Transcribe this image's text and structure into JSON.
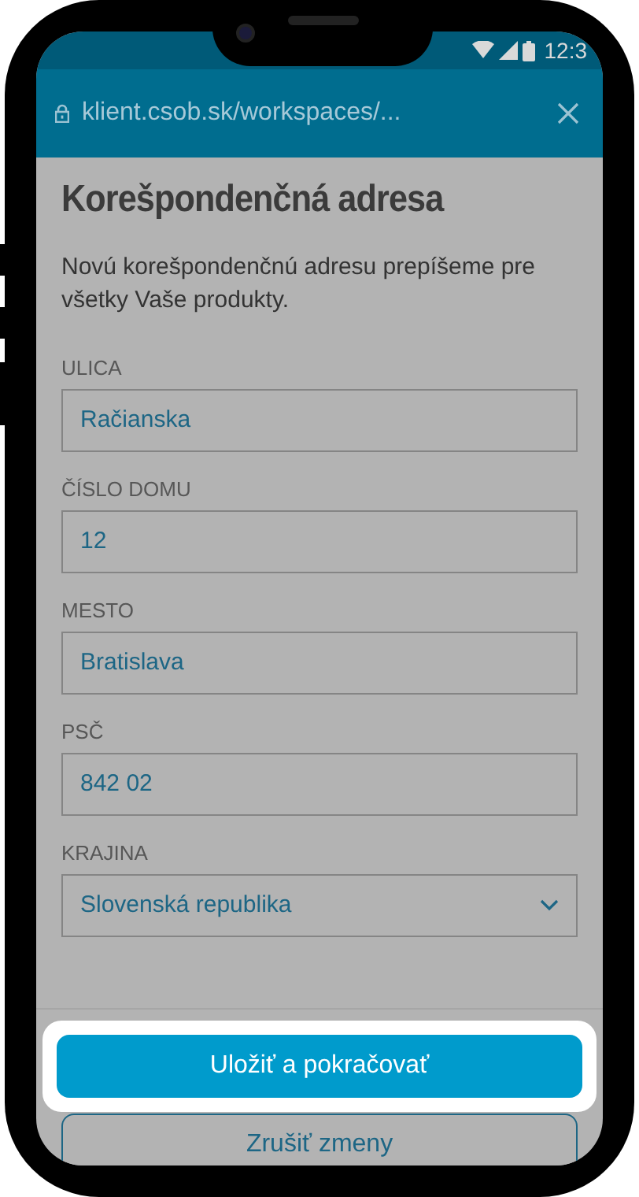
{
  "status_bar": {
    "time": "12:3"
  },
  "browser": {
    "url": "klient.csob.sk/workspaces/..."
  },
  "page": {
    "title": "Korešpondenčná adresa",
    "description": "Novú korešpondenčnú adresu prepíšeme pre všetky Vaše produkty.",
    "fields": [
      {
        "label": "ULICA",
        "value": "Račianska",
        "kind": "text"
      },
      {
        "label": "ČÍSLO DOMU",
        "value": "12",
        "kind": "text"
      },
      {
        "label": "MESTO",
        "value": "Bratislava",
        "kind": "text"
      },
      {
        "label": "PSČ",
        "value": "842 02",
        "kind": "text"
      },
      {
        "label": "KRAJINA",
        "value": "Slovenská republika",
        "kind": "select"
      }
    ]
  },
  "buttons": [
    {
      "label": "Uložiť a pokračovať",
      "kind": "primary",
      "highlighted": true
    },
    {
      "label": "Zrušiť zmeny",
      "kind": "secondary",
      "highlighted": false
    }
  ]
}
